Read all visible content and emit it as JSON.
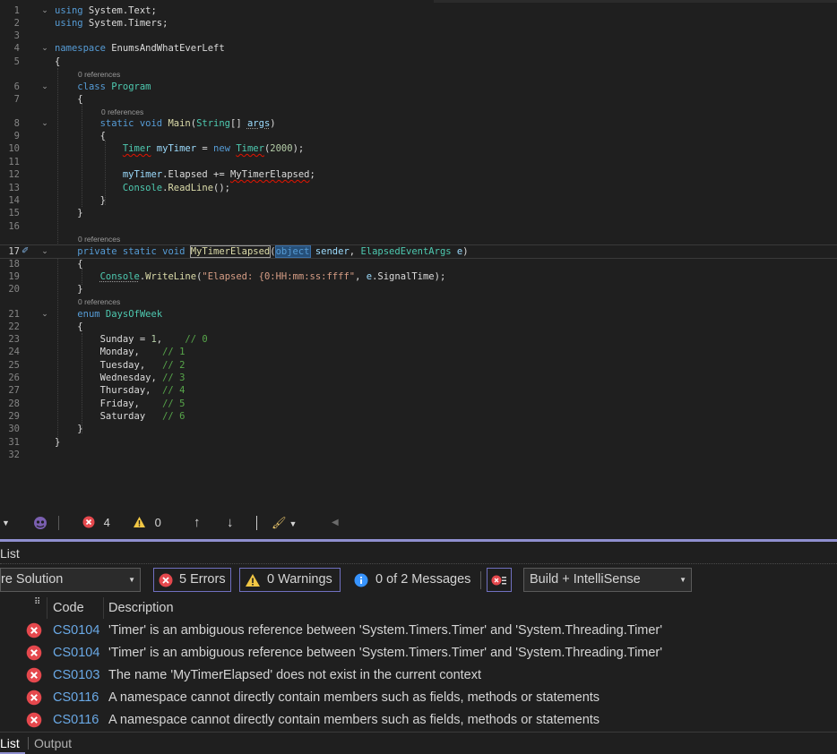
{
  "editor": {
    "lines": [
      {
        "n": "1",
        "tokens": [
          [
            "kw",
            "using"
          ],
          [
            "nm",
            " System.Text;"
          ]
        ]
      },
      {
        "n": "2",
        "tokens": [
          [
            "kw",
            "using"
          ],
          [
            "nm",
            " System.Timers;"
          ]
        ]
      },
      {
        "n": "3",
        "tokens": []
      },
      {
        "n": "4",
        "tokens": [
          [
            "kw",
            "namespace"
          ],
          [
            "nm",
            " EnumsAndWhatEverLeft"
          ]
        ]
      },
      {
        "n": "5",
        "tokens": [
          [
            "nm",
            "{"
          ]
        ]
      },
      {
        "n": "6",
        "tokens": [
          [
            "nm",
            "    "
          ],
          [
            "kw",
            "class"
          ],
          [
            "nm",
            " "
          ],
          [
            "ty",
            "Program"
          ]
        ]
      },
      {
        "n": "7",
        "tokens": [
          [
            "nm",
            "    {"
          ]
        ]
      },
      {
        "n": "8",
        "tokens": [
          [
            "nm",
            "        "
          ],
          [
            "kw",
            "static void"
          ],
          [
            "nm",
            " "
          ],
          [
            "fn",
            "Main"
          ],
          [
            "nm",
            "("
          ],
          [
            "ty",
            "String"
          ],
          [
            "nm",
            "[] "
          ],
          [
            "pm sug",
            "args"
          ],
          [
            "nm",
            ")"
          ]
        ]
      },
      {
        "n": "9",
        "tokens": [
          [
            "nm",
            "        {"
          ]
        ]
      },
      {
        "n": "10",
        "tokens": [
          [
            "nm",
            "            "
          ],
          [
            "ty err",
            "Timer"
          ],
          [
            "nm",
            " "
          ],
          [
            "id",
            "myTimer"
          ],
          [
            "nm",
            " = "
          ],
          [
            "kw",
            "new"
          ],
          [
            "nm",
            " "
          ],
          [
            "ty err",
            "Timer"
          ],
          [
            "nm",
            "("
          ],
          [
            "nu",
            "2000"
          ],
          [
            "nm",
            ");"
          ]
        ]
      },
      {
        "n": "11",
        "tokens": []
      },
      {
        "n": "12",
        "tokens": [
          [
            "nm",
            "            "
          ],
          [
            "id",
            "myTimer"
          ],
          [
            "nm",
            "."
          ],
          [
            "nm",
            "Elapsed += "
          ],
          [
            "nm err",
            "MyTimerElapsed"
          ],
          [
            "nm",
            ";"
          ]
        ]
      },
      {
        "n": "13",
        "tokens": [
          [
            "nm",
            "            "
          ],
          [
            "ty",
            "Console"
          ],
          [
            "nm",
            "."
          ],
          [
            "fn",
            "ReadLine"
          ],
          [
            "nm",
            "();"
          ]
        ]
      },
      {
        "n": "14",
        "tokens": [
          [
            "nm",
            "        }"
          ]
        ]
      },
      {
        "n": "15",
        "tokens": [
          [
            "nm",
            "    }"
          ]
        ]
      },
      {
        "n": "16",
        "tokens": []
      },
      {
        "n": "17",
        "tokens": [
          [
            "nm",
            "    "
          ],
          [
            "kw",
            "private static void"
          ],
          [
            "nm",
            " "
          ],
          [
            "fn hl-ref",
            "MyTimerElapsed"
          ],
          [
            "nm",
            "("
          ],
          [
            "kw hl-obj",
            "object"
          ],
          [
            "nm",
            " "
          ],
          [
            "pm",
            "sender"
          ],
          [
            "nm",
            ", "
          ],
          [
            "ty",
            "ElapsedEventArgs"
          ],
          [
            "nm",
            " "
          ],
          [
            "pm",
            "e"
          ],
          [
            "nm",
            ")"
          ]
        ]
      },
      {
        "n": "18",
        "tokens": [
          [
            "nm",
            "    {"
          ]
        ]
      },
      {
        "n": "19",
        "tokens": [
          [
            "nm",
            "        "
          ],
          [
            "ty sug",
            "Console"
          ],
          [
            "nm",
            "."
          ],
          [
            "fn",
            "WriteLine"
          ],
          [
            "nm",
            "("
          ],
          [
            "st",
            "\"Elapsed: {0:HH:mm:ss:ffff\""
          ],
          [
            "nm",
            ", "
          ],
          [
            "pm",
            "e"
          ],
          [
            "nm",
            "."
          ],
          [
            "nm",
            "SignalTime);"
          ]
        ]
      },
      {
        "n": "20",
        "tokens": [
          [
            "nm",
            "    }"
          ]
        ]
      },
      {
        "n": "21",
        "tokens": [
          [
            "nm",
            "    "
          ],
          [
            "kw",
            "enum"
          ],
          [
            "nm",
            " "
          ],
          [
            "ty",
            "DaysOfWeek"
          ]
        ]
      },
      {
        "n": "22",
        "tokens": [
          [
            "nm",
            "    {"
          ]
        ]
      },
      {
        "n": "23",
        "tokens": [
          [
            "nm",
            "        Sunday = "
          ],
          [
            "nu",
            "1"
          ],
          [
            "nm",
            ",    "
          ],
          [
            "cm",
            "// 0"
          ]
        ]
      },
      {
        "n": "24",
        "tokens": [
          [
            "nm",
            "        Monday,    "
          ],
          [
            "cm",
            "// 1"
          ]
        ]
      },
      {
        "n": "25",
        "tokens": [
          [
            "nm",
            "        Tuesday,   "
          ],
          [
            "cm",
            "// 2"
          ]
        ]
      },
      {
        "n": "26",
        "tokens": [
          [
            "nm",
            "        Wednesday, "
          ],
          [
            "cm",
            "// 3"
          ]
        ]
      },
      {
        "n": "27",
        "tokens": [
          [
            "nm",
            "        Thursday,  "
          ],
          [
            "cm",
            "// 4"
          ]
        ]
      },
      {
        "n": "28",
        "tokens": [
          [
            "nm",
            "        Friday,    "
          ],
          [
            "cm",
            "// 5"
          ]
        ]
      },
      {
        "n": "29",
        "tokens": [
          [
            "nm",
            "        Saturday   "
          ],
          [
            "cm",
            "// 6"
          ]
        ]
      },
      {
        "n": "30",
        "tokens": [
          [
            "nm",
            "    }"
          ]
        ]
      },
      {
        "n": "31",
        "tokens": [
          [
            "nm",
            "}"
          ]
        ]
      },
      {
        "n": "32",
        "tokens": []
      }
    ],
    "codelens": [
      "0 references",
      "0 references",
      "0 references",
      "0 references"
    ]
  },
  "status_bar": {
    "error_count": "4",
    "warning_count": "0"
  },
  "error_list": {
    "title": "List",
    "scope": "re Solution",
    "errors_button": "5 Errors",
    "warnings_button": "0 Warnings",
    "messages_button": "0 of 2 Messages",
    "filter": "Build + IntelliSense",
    "columns": {
      "code": "Code",
      "description": "Description"
    },
    "rows": [
      {
        "code": "CS0104",
        "description": "'Timer' is an ambiguous reference between 'System.Timers.Timer' and 'System.Threading.Timer'"
      },
      {
        "code": "CS0104",
        "description": "'Timer' is an ambiguous reference between 'System.Timers.Timer' and 'System.Threading.Timer'"
      },
      {
        "code": "CS0103",
        "description": "The name 'MyTimerElapsed' does not exist in the current context"
      },
      {
        "code": "CS0116",
        "description": "A namespace cannot directly contain members such as fields, methods or statements"
      },
      {
        "code": "CS0116",
        "description": "A namespace cannot directly contain members such as fields, methods or statements"
      }
    ]
  },
  "bottom_tabs": [
    "List",
    "Output"
  ],
  "colors": {
    "error": "#e5484d",
    "accent": "#8f8fcf",
    "warning": "#f2c744",
    "info": "#3794ff",
    "link": "#6aa9e6"
  }
}
